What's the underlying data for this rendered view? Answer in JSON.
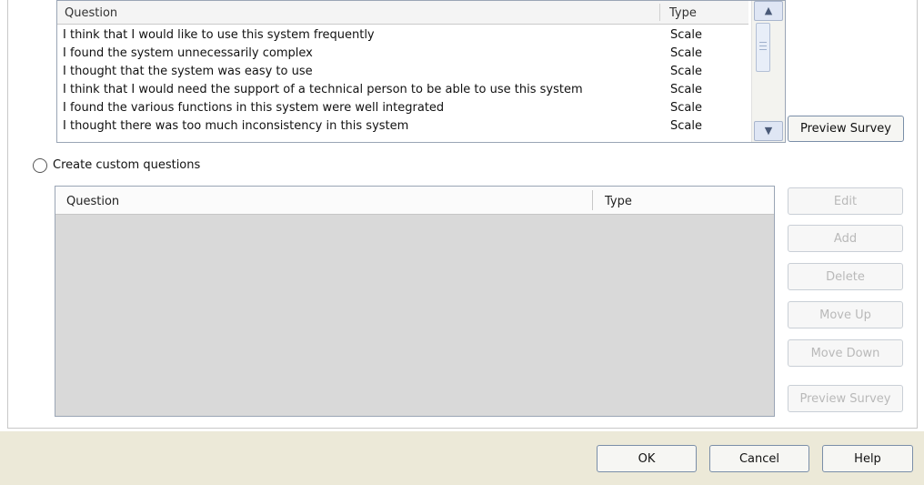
{
  "preset_list": {
    "columns": {
      "question": "Question",
      "type": "Type"
    },
    "rows": [
      {
        "question": "I think that I would like to use this system frequently",
        "type": "Scale"
      },
      {
        "question": "I found the system unnecessarily complex",
        "type": "Scale"
      },
      {
        "question": "I thought that the system was easy to use",
        "type": "Scale"
      },
      {
        "question": "I think that I would need the support of a technical person to be able to use this system",
        "type": "Scale"
      },
      {
        "question": "I found the various functions in this system were well integrated",
        "type": "Scale"
      },
      {
        "question": "I thought there was too much inconsistency in this system",
        "type": "Scale"
      }
    ],
    "preview_label": "Preview Survey"
  },
  "custom": {
    "radio_label": "Create custom questions",
    "columns": {
      "question": "Question",
      "type": "Type"
    },
    "buttons": {
      "edit": "Edit",
      "add": "Add",
      "delete": "Delete",
      "move_up": "Move Up",
      "move_down": "Move Down",
      "preview": "Preview Survey"
    }
  },
  "footer": {
    "ok": "OK",
    "cancel": "Cancel",
    "help": "Help"
  },
  "icons": {
    "scroll_up": "chevron-up-icon",
    "scroll_down": "chevron-down-icon"
  },
  "colors": {
    "footer_bg": "#ece9d8",
    "button_border": "#7a8ea8",
    "disabled_text": "#b9b9b9"
  }
}
